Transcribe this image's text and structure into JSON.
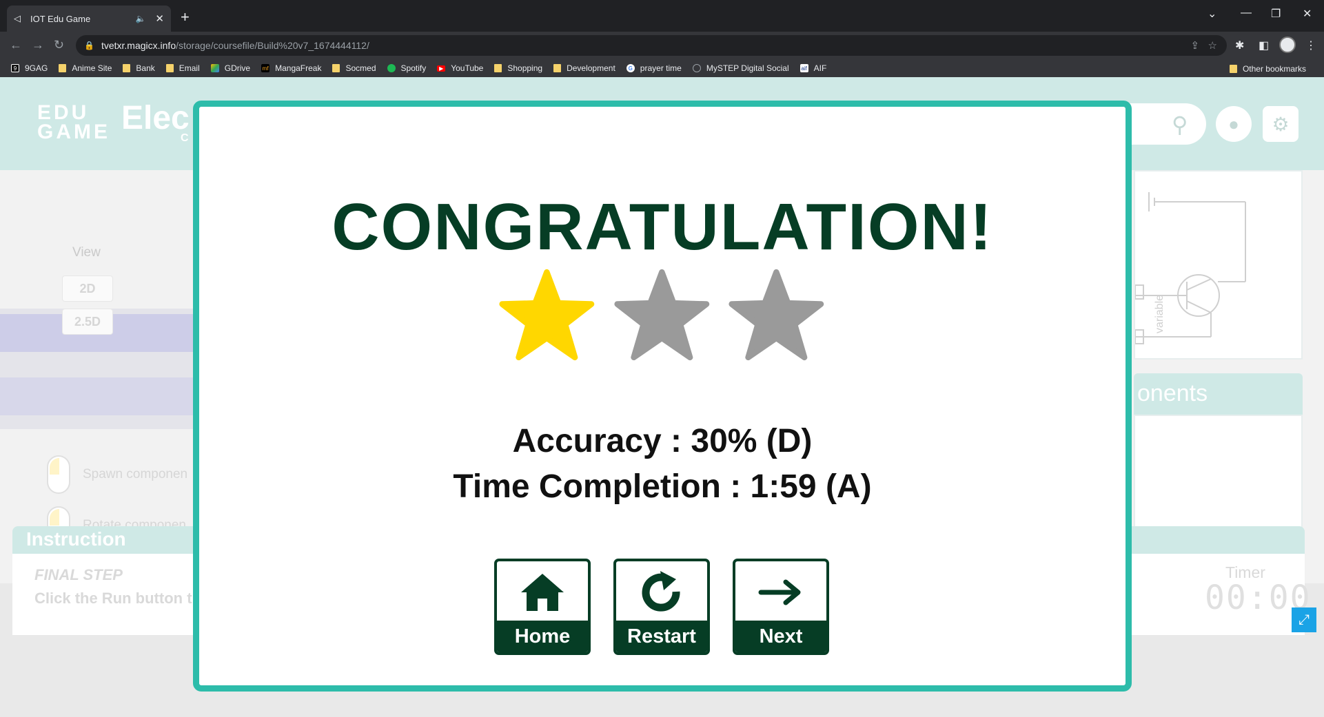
{
  "browser": {
    "tab_title": "IOT Edu Game",
    "url_host": "tvetxr.magicx.info",
    "url_path": "/storage/coursefile/Build%20v7_1674444112/",
    "bookmarks": [
      "9GAG",
      "Anime Site",
      "Bank",
      "Email",
      "GDrive",
      "MangaFreak",
      "Socmed",
      "Spotify",
      "YouTube",
      "Shopping",
      "Development",
      "prayer time",
      "MySTEP Digital Social",
      "AIF"
    ],
    "other_bookmarks": "Other bookmarks"
  },
  "game": {
    "logo_line1": "EDU",
    "logo_line2": "GAME",
    "title_fragment": "Elec",
    "subtitle_fragment": "C",
    "view_label": "View",
    "view_2d": "2D",
    "view_25d": "2.5D",
    "hint_spawn": "Spawn componen",
    "hint_rotate": "Rotate componen",
    "components_label": "onents",
    "circuit_label": "variable",
    "instruction_title": "Instruction",
    "step_title": "FINAL STEP",
    "step_text": "Click the Run button t",
    "timer_label": "Timer",
    "timer_value": "00:00"
  },
  "modal": {
    "title": "CONGRATULATION!",
    "stars_earned": 1,
    "stars_total": 3,
    "star_color_on": "#FFD700",
    "star_color_off": "#9A9A9A",
    "accuracy_text": "Accuracy : 30% (D)",
    "time_text": "Time Completion : 1:59 (A)",
    "buttons": {
      "home": "Home",
      "restart": "Restart",
      "next": "Next"
    },
    "accent_color": "#2DBCAA",
    "dark_green": "#063D25"
  }
}
